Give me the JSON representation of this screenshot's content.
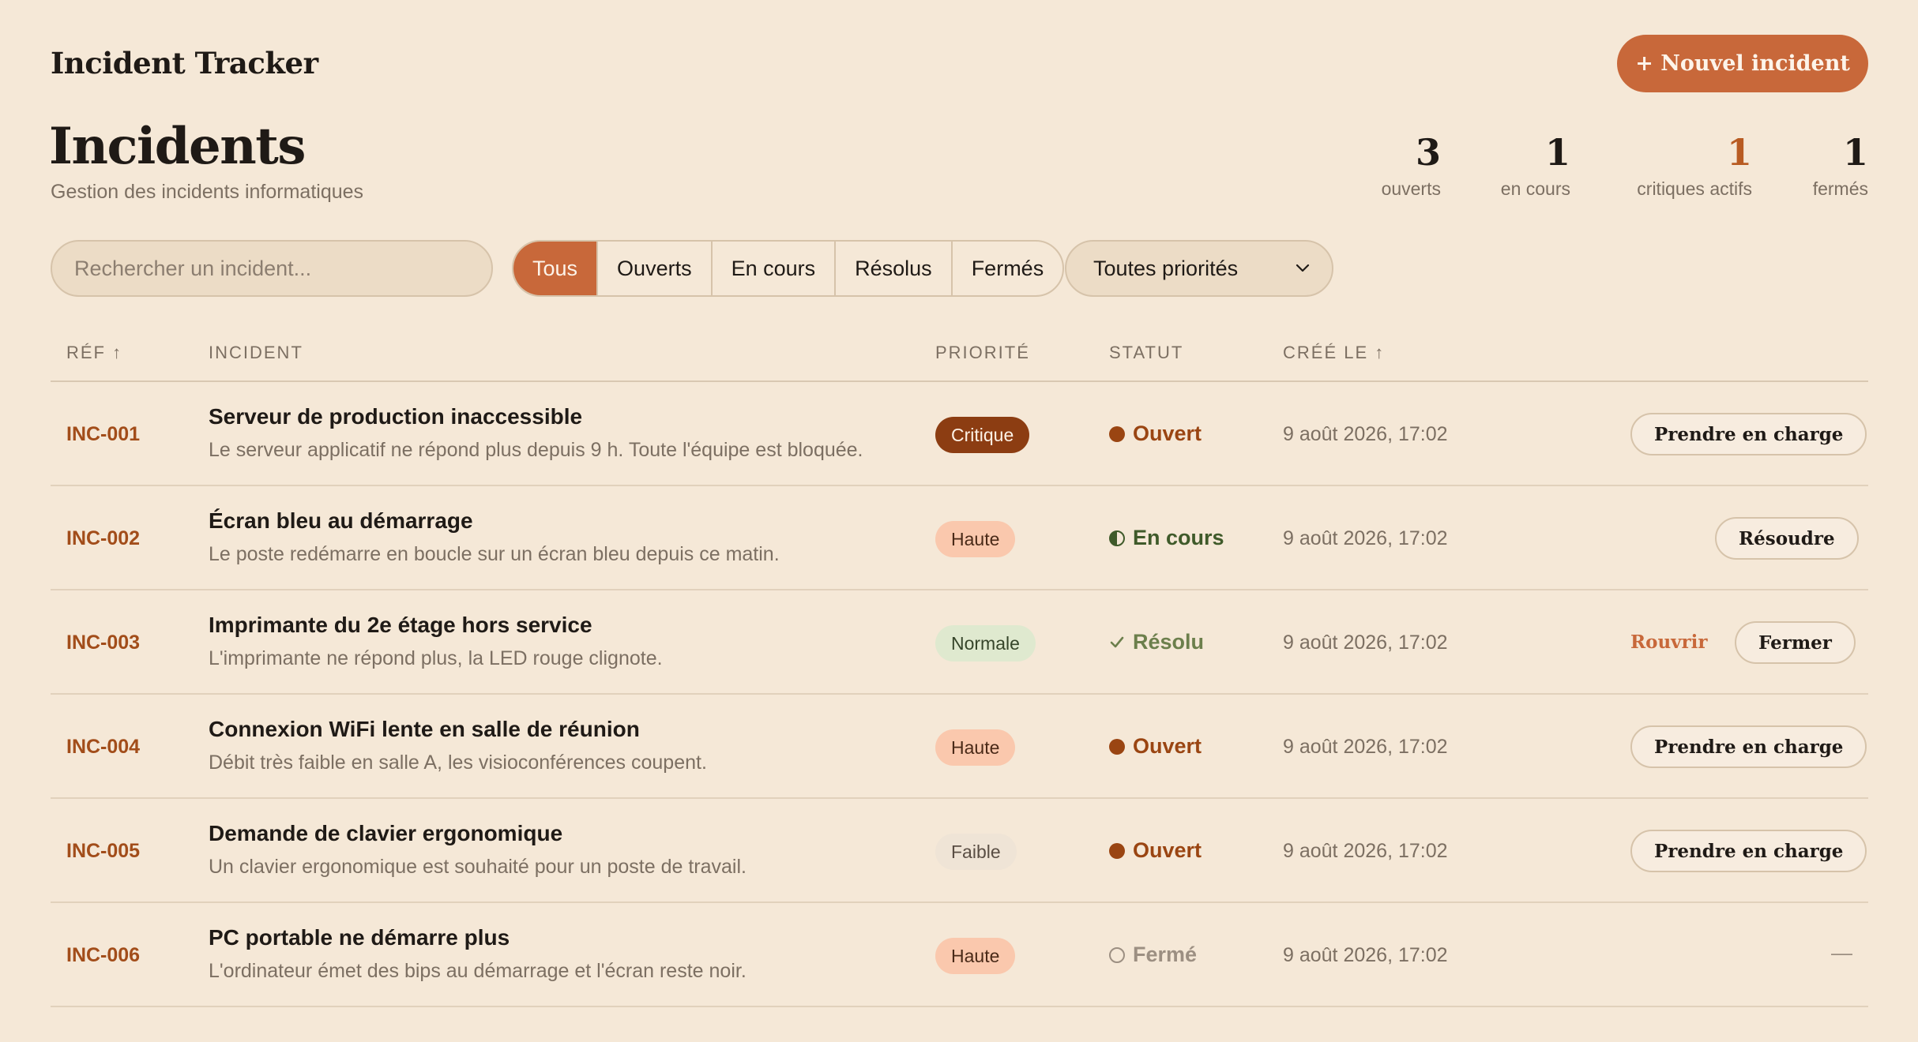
{
  "app": {
    "title": "Incident Tracker",
    "new_button": "+ Nouvel incident"
  },
  "page": {
    "title": "Incidents",
    "subtitle": "Gestion des incidents informatiques"
  },
  "stats": [
    {
      "value": "3",
      "label": "ouverts"
    },
    {
      "value": "1",
      "label": "en cours"
    },
    {
      "value": "1",
      "label": "critiques actifs"
    },
    {
      "value": "1",
      "label": "fermés"
    }
  ],
  "search": {
    "placeholder": "Rechercher un incident..."
  },
  "filters": [
    "Tous",
    "Ouverts",
    "En cours",
    "Résolus",
    "Fermés"
  ],
  "active_filter": "Tous",
  "priority_select": {
    "value": "Toutes priorités"
  },
  "columns": {
    "ref": "RÉF ↑",
    "incident": "INCIDENT",
    "priority": "PRIORITÉ",
    "status": "STATUT",
    "created": "CRÉÉ LE ↑"
  },
  "incidents": [
    {
      "ref": "INC-001",
      "title": "Serveur de production inaccessible",
      "desc": "Le serveur applicatif ne répond plus depuis 9 h. Toute l'équipe est bloquée.",
      "priority": "Critique",
      "status": "Ouvert",
      "created": "9 août 2026, 17:02",
      "action": "Prendre en charge"
    },
    {
      "ref": "INC-002",
      "title": "Écran bleu au démarrage",
      "desc": "Le poste redémarre en boucle sur un écran bleu depuis ce matin.",
      "priority": "Haute",
      "status": "En cours",
      "created": "9 août 2026, 17:02",
      "action": "Résoudre"
    },
    {
      "ref": "INC-003",
      "title": "Imprimante du 2e étage hors service",
      "desc": "L'imprimante ne répond plus, la LED rouge clignote.",
      "priority": "Normale",
      "status": "Résolu",
      "created": "9 août 2026, 17:02",
      "action_secondary": "Rouvrir",
      "action": "Fermer"
    },
    {
      "ref": "INC-004",
      "title": "Connexion WiFi lente en salle de réunion",
      "desc": "Débit très faible en salle A, les visioconférences coupent.",
      "priority": "Haute",
      "status": "Ouvert",
      "created": "9 août 2026, 17:02",
      "action": "Prendre en charge"
    },
    {
      "ref": "INC-005",
      "title": "Demande de clavier ergonomique",
      "desc": "Un clavier ergonomique est souhaité pour un poste de travail.",
      "priority": "Faible",
      "status": "Ouvert",
      "created": "9 août 2026, 17:02",
      "action": "Prendre en charge"
    },
    {
      "ref": "INC-006",
      "title": "PC portable ne démarre plus",
      "desc": "L'ordinateur émet des bips au démarrage et l'écran reste noir.",
      "priority": "Haute",
      "status": "Fermé",
      "created": "9 août 2026, 17:02",
      "action": "—"
    }
  ],
  "colors": {
    "accent": "#c8683a",
    "background": "#f5e8d7",
    "critical": "#8c3d12"
  }
}
